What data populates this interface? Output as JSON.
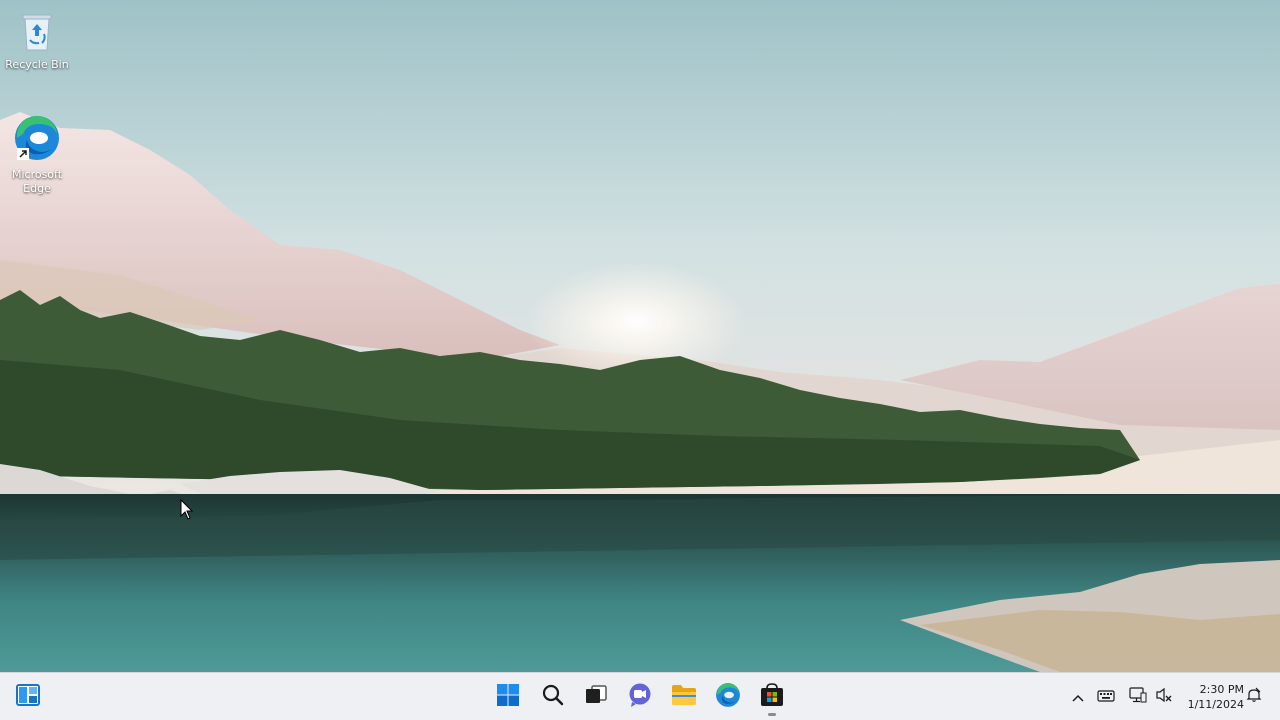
{
  "desktop": {
    "icons": [
      {
        "label": "Recycle Bin",
        "icon": "recycle-bin-icon"
      },
      {
        "label": "Microsoft\nEdge",
        "icon": "edge-icon"
      }
    ]
  },
  "taskbar": {
    "apps": [
      {
        "name": "Start",
        "icon": "windows-start-icon"
      },
      {
        "name": "Search",
        "icon": "search-icon"
      },
      {
        "name": "Task View",
        "icon": "task-view-icon"
      },
      {
        "name": "Chat",
        "icon": "teams-chat-icon"
      },
      {
        "name": "File Explorer",
        "icon": "folder-icon"
      },
      {
        "name": "Microsoft Edge",
        "icon": "edge-icon"
      },
      {
        "name": "Microsoft Store",
        "icon": "store-icon"
      }
    ],
    "widgets_icon": "widgets-icon",
    "tray": {
      "icons": [
        "chevron-up-icon",
        "keyboard-icon",
        "network-icon",
        "volume-muted-icon"
      ],
      "time": "2:30 PM",
      "date": "1/11/2024",
      "notification_icon": "notification-icon"
    }
  },
  "colors": {
    "taskbar_bg": "#eef0f3",
    "accent": "#0078d4"
  }
}
